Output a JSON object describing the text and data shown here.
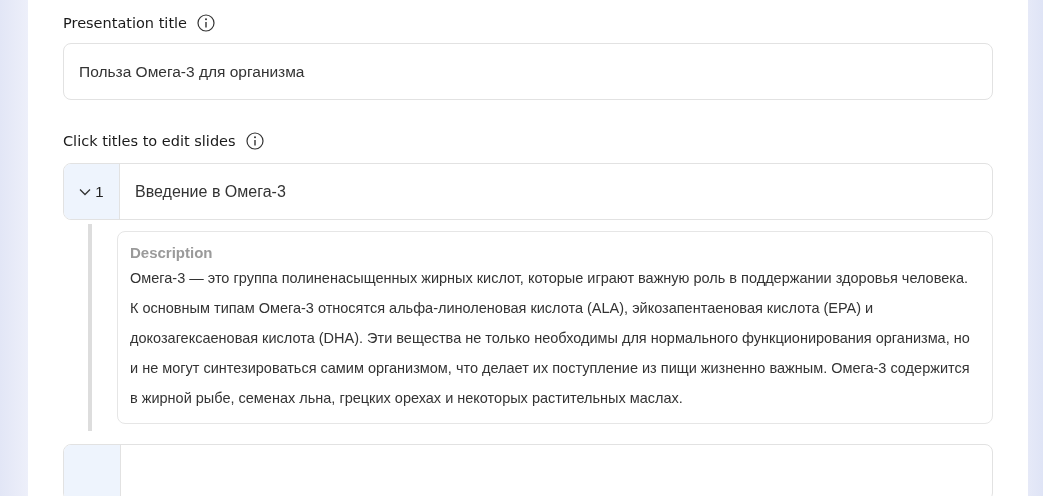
{
  "presentation_title": {
    "label": "Presentation title",
    "value": "Польза Омега-3 для организма"
  },
  "slides_section": {
    "label": "Click titles to edit slides"
  },
  "slides": [
    {
      "number": "1",
      "title": "Введение в Омега-3",
      "expanded": true,
      "description_label": "Description",
      "description": "Омега-3 — это группа полиненасыщенных жирных кислот, которые играют важную роль в поддержании здоровья человека. К основным типам Омега-3 относятся альфа-линоленовая кислота (ALA), эйкозапентаеновая кислота (EPA) и докозагексаеновая кислота (DHA). Эти вещества не только необходимы для нормального функционирования организма, но и не могут синтезироваться самим организмом, что делает их поступление из пищи жизненно важным. Омега-3 содержится в жирной рыбе, семенах льна, грецких орехах и некоторых растительных маслах."
    }
  ]
}
